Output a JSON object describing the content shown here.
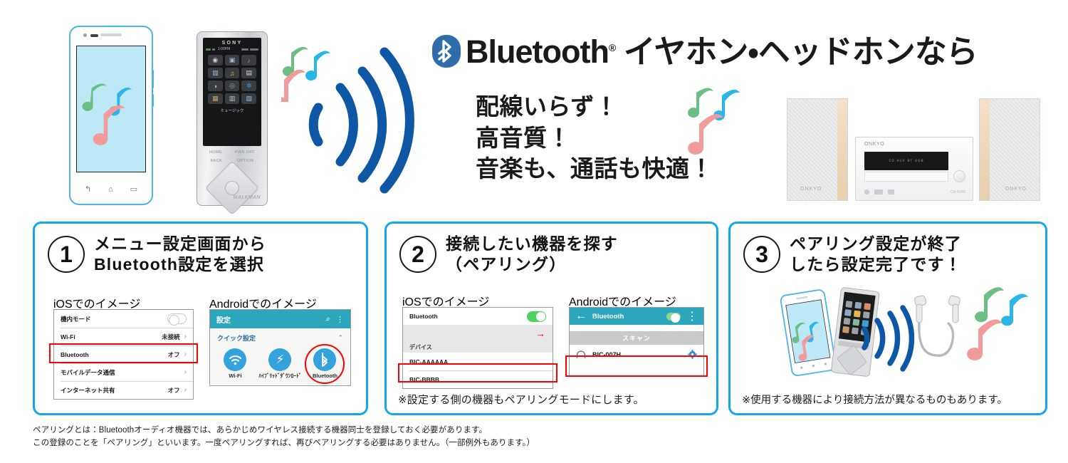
{
  "hero": {
    "brand_logo": "bluetooth-logo",
    "title": "Bluetooth",
    "title_suffix": " イヤホン・ヘッドホンなら",
    "registered_mark": "®",
    "benefits": [
      "配線いらず！",
      "高音質！",
      "音楽も、通話も快適！"
    ],
    "phone": {
      "nav_back": "↰",
      "nav_home": "⌂",
      "nav_recent": "▭"
    },
    "walkman": {
      "brand": "SONY",
      "time": "1:00PM",
      "app_label": "ミュージック",
      "icons": [
        "◉",
        "▣",
        "♪",
        "▨",
        "♫",
        "▤",
        "◑",
        "◎",
        "✦",
        "▦",
        "▥",
        "▧"
      ],
      "keys": [
        "HOME",
        "PWR OFF",
        "BACK",
        "OPTION"
      ],
      "wordmark": "WALKMAN"
    },
    "stereo": {
      "brand": "ONKYO",
      "display": "ᴄᴅ ᴀᴜx ʙᴛ ᴜꜱʙ",
      "model": "CR-N765"
    }
  },
  "steps": [
    {
      "number": "①",
      "number_plain": "1",
      "title_line1": "メニュー設定画面から",
      "title_line2": "Bluetooth設定を選択",
      "ios_label": "iOSでのイメージ",
      "android_label": "Androidでのイメージ",
      "ios_rows": [
        {
          "label": "機内モード",
          "value": "",
          "control": "toggle-off",
          "chevron": false
        },
        {
          "label": "Wi-Fi",
          "value": "未接続",
          "control": "",
          "chevron": true
        },
        {
          "label": "Bluetooth",
          "value": "オフ",
          "control": "",
          "chevron": true,
          "highlight": true
        },
        {
          "label": "モバイルデータ通信",
          "value": "",
          "control": "",
          "chevron": true
        },
        {
          "label": "インターネット共有",
          "value": "オフ",
          "control": "",
          "chevron": true
        }
      ],
      "android": {
        "title": "設定",
        "search_icon": "search-icon",
        "menu_icon": "overflow-menu-icon",
        "section": "クイック設定",
        "collapse_icon": "chevron-up-icon",
        "tiles": [
          {
            "icon": "wifi-icon",
            "glyph": "⌃",
            "caption": "Wi-Fi",
            "highlight": false
          },
          {
            "icon": "hybrid-download-icon",
            "glyph": "⚡",
            "caption": "ﾊｲﾌﾞﾘｯﾄﾞﾀﾞｳﾝﾛｰﾄﾞ",
            "highlight": false
          },
          {
            "icon": "bluetooth-icon",
            "glyph": "✲",
            "caption": "Bluetooth",
            "highlight": true
          }
        ]
      }
    },
    {
      "number": "②",
      "number_plain": "2",
      "title_line1": "接続したい機器を探す",
      "title_line2": "（ペアリング）",
      "ios_label": "iOSでのイメージ",
      "android_label": "Androidでのイメージ",
      "ios": {
        "bluetooth_label": "Bluetooth",
        "toggle_state": "on",
        "arrow": "→",
        "devices_header": "デバイス",
        "devices": [
          {
            "name": "BIC-AAAAAA",
            "highlight": true
          },
          {
            "name": "BIC-BBBB",
            "highlight": false
          }
        ]
      },
      "android": {
        "back_icon": "back-arrow-icon",
        "title": "Bluetooth",
        "toggle_state": "on",
        "menu_icon": "overflow-menu-icon",
        "scan_label": "スキャン",
        "device": {
          "icon": "headphone-icon",
          "name": "BIC-007H",
          "settings_icon": "gear-icon"
        }
      },
      "note": "※設定する側の機器もペアリングモードにします。"
    },
    {
      "number": "③",
      "number_plain": "3",
      "title_line1": "ペアリング設定が終了",
      "title_line2": "したら設定完了です！",
      "note": "※使用する機器により接続方法が異なるものもあります。"
    }
  ],
  "footer": {
    "line1": "ペアリングとは：Bluetoothオーディオ機器では、あらかじめワイヤレス接続する機器同士を登録しておく必要があります。",
    "line2": "この登録のことを「ペアリング」といいます。一度ペアリングすれば、再びペアリングする必要はありません。（一部例外もあります。）"
  },
  "colors": {
    "accent_blue": "#14a7ea",
    "wave_blue": "#0d57a5",
    "bt_logo_blue": "#2e6daa",
    "android_teal": "#2ba6bd",
    "android_tile": "#33a2dd",
    "toggle_green": "#4cd35f",
    "highlight_red": "#ff0000",
    "note_green": "#6cbf84",
    "note_blue": "#29b6e8",
    "note_pink": "#f29b9b"
  }
}
